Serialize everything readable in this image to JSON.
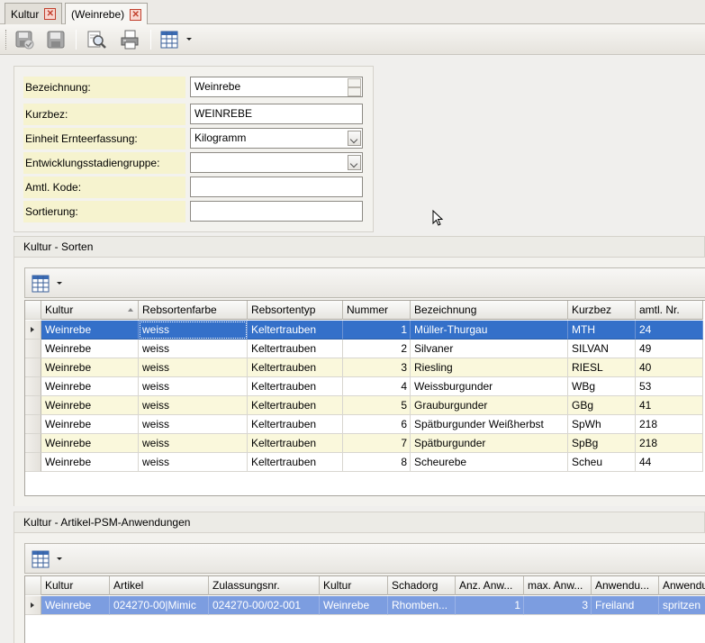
{
  "tabs": [
    {
      "label": "Kultur"
    },
    {
      "label": "(Weinrebe)"
    }
  ],
  "form": {
    "fields": [
      {
        "label": "Bezeichnung:",
        "value": "Weinrebe",
        "kind": "spin"
      },
      {
        "label": "Kurzbez:",
        "value": "WEINREBE",
        "kind": "text"
      },
      {
        "label": "Einheit Ernteerfassung:",
        "value": "Kilogramm",
        "kind": "dropdown"
      },
      {
        "label": "Entwicklungsstadiengruppe:",
        "value": "",
        "kind": "dropdown"
      },
      {
        "label": "Amtl. Kode:",
        "value": "",
        "kind": "text"
      },
      {
        "label": "Sortierung:",
        "value": "",
        "kind": "text"
      }
    ]
  },
  "sorten": {
    "title": "Kultur - Sorten",
    "columns": [
      "Kultur",
      "Rebsortenfarbe",
      "Rebsortentyp",
      "Nummer",
      "Bezeichnung",
      "Kurzbez",
      "amtl. Nr."
    ],
    "rows": [
      [
        "Weinrebe",
        "weiss",
        "Keltertrauben",
        "1",
        "Müller-Thurgau",
        "MTH",
        "24"
      ],
      [
        "Weinrebe",
        "weiss",
        "Keltertrauben",
        "2",
        "Silvaner",
        "SILVAN",
        "49"
      ],
      [
        "Weinrebe",
        "weiss",
        "Keltertrauben",
        "3",
        "Riesling",
        "RIESL",
        "40"
      ],
      [
        "Weinrebe",
        "weiss",
        "Keltertrauben",
        "4",
        "Weissburgunder",
        "WBg",
        "53"
      ],
      [
        "Weinrebe",
        "weiss",
        "Keltertrauben",
        "5",
        "Grauburgunder",
        "GBg",
        "41"
      ],
      [
        "Weinrebe",
        "weiss",
        "Keltertrauben",
        "6",
        "Spätburgunder Weißherbst",
        "SpWh",
        "218"
      ],
      [
        "Weinrebe",
        "weiss",
        "Keltertrauben",
        "7",
        "Spätburgunder",
        "SpBg",
        "218"
      ],
      [
        "Weinrebe",
        "weiss",
        "Keltertrauben",
        "8",
        "Scheurebe",
        "Scheu",
        "44"
      ]
    ]
  },
  "psm": {
    "title": "Kultur - Artikel-PSM-Anwendungen",
    "columns": [
      "Kultur",
      "Artikel",
      "Zulassungsnr.",
      "Kultur",
      "Schadorg",
      "Anz. Anw...",
      "max. Anw...",
      "Anwendu...",
      "Anwendu"
    ],
    "rows": [
      [
        "Weinrebe",
        "024270-00|Mimic",
        "024270-00/02-001",
        "Weinrebe",
        "Rhomben...",
        "1",
        "3",
        "Freiland",
        "spritzen"
      ]
    ]
  },
  "colors": {
    "selection": "#3470c9",
    "selection_inactive": "#7c9de0",
    "label_bg": "#f6f3cf",
    "row_alt": "#faf8dc"
  }
}
